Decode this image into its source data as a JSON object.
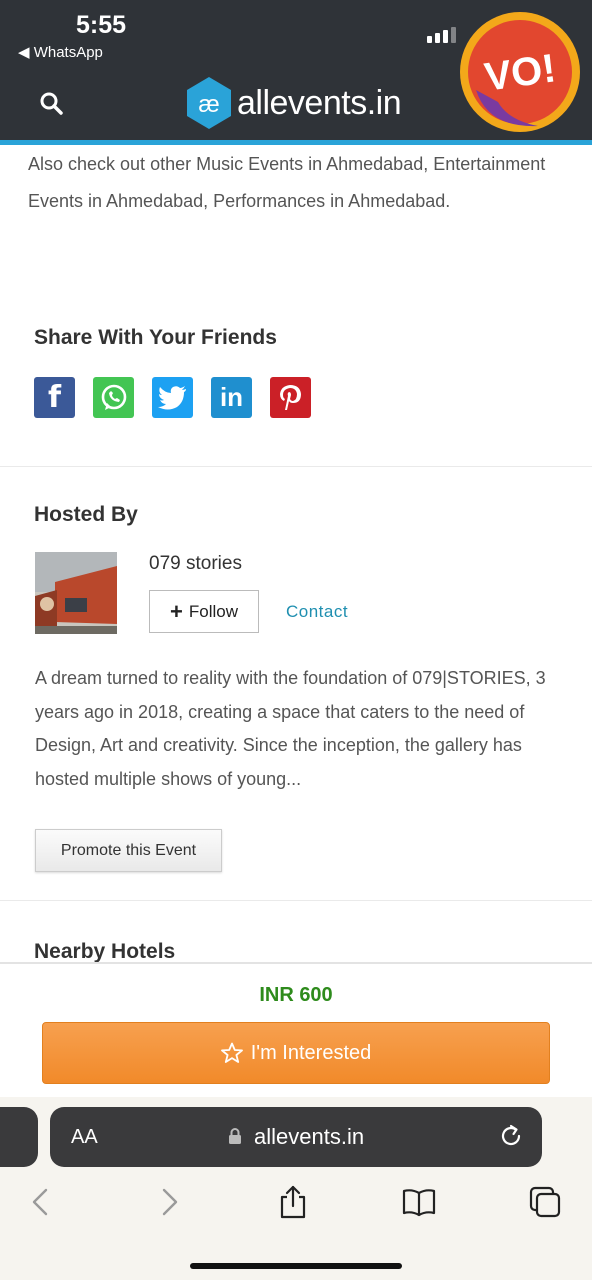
{
  "status_bar": {
    "time": "5:55",
    "back_app": "◀ WhatsApp"
  },
  "header": {
    "logo_text": "allevents.in",
    "badge_text": "VO!"
  },
  "also_text": "Also check out other Music Events in Ahmedabad, Entertainment Events in Ahmedabad, Performances in Ahmedabad.",
  "share": {
    "title": "Share With Your Friends",
    "buttons": [
      {
        "name": "facebook",
        "glyph": "f",
        "color": "#3b5998"
      },
      {
        "name": "whatsapp",
        "glyph": "✆",
        "color": "#43c553"
      },
      {
        "name": "twitter",
        "glyph": "🐦",
        "color": "#1da1f2"
      },
      {
        "name": "linkedin",
        "glyph": "in",
        "color": "#1f8fcf"
      },
      {
        "name": "pinterest",
        "glyph": "P",
        "color": "#cb2027"
      }
    ]
  },
  "hosted": {
    "title": "Hosted By",
    "name": "079 stories",
    "follow_label": "Follow",
    "contact_label": "Contact",
    "description": "A dream turned to reality with the foundation of 079|STORIES, 3 years ago in 2018, creating a space that caters to the need of Design, Art and creativity. Since the inception, the gallery has hosted multiple shows of young...",
    "promote_label": "Promote this Event"
  },
  "nearby": {
    "title": "Nearby Hotels"
  },
  "sticky": {
    "price": "INR 600",
    "interested_label": "I'm Interested"
  },
  "safari": {
    "aa": "AA",
    "url": "allevents.in"
  }
}
